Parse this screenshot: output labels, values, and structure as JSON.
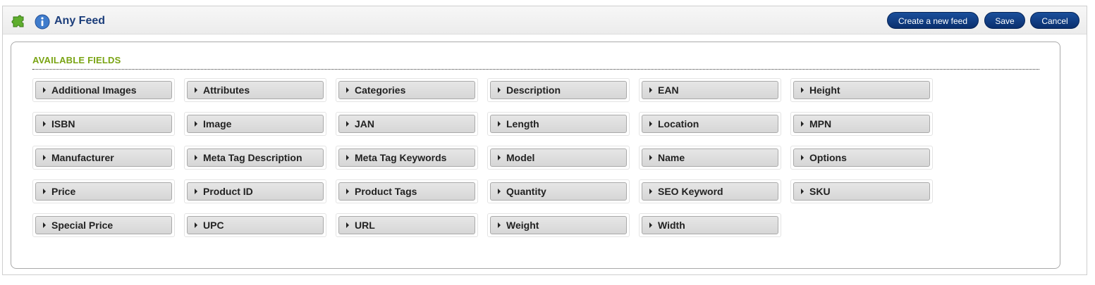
{
  "header": {
    "title": "Any Feed",
    "icons": [
      "puzzle-icon",
      "info-icon"
    ],
    "buttons": {
      "create_label": "Create a new feed",
      "save_label": "Save",
      "cancel_label": "Cancel"
    }
  },
  "section": {
    "title": "AVAILABLE FIELDS"
  },
  "fields": [
    "Additional Images",
    "Attributes",
    "Categories",
    "Description",
    "EAN",
    "Height",
    "ISBN",
    "Image",
    "JAN",
    "Length",
    "Location",
    "MPN",
    "Manufacturer",
    "Meta Tag Description",
    "Meta Tag Keywords",
    "Model",
    "Name",
    "Options",
    "Price",
    "Product ID",
    "Product Tags",
    "Quantity",
    "SEO Keyword",
    "SKU",
    "Special Price",
    "UPC",
    "URL",
    "Weight",
    "Width"
  ],
  "colors": {
    "accent_title": "#1b3d7a",
    "button_bg": "#0d3a80",
    "section_title": "#7aa414"
  }
}
